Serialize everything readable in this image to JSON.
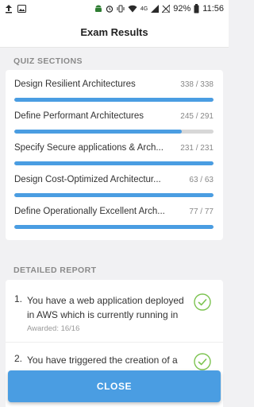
{
  "status_bar": {
    "battery_percent": "92%",
    "time": "11:56",
    "network_label": "4G"
  },
  "header": {
    "title": "Exam Results"
  },
  "quiz_sections": {
    "title": "QUIZ SECTIONS",
    "items": [
      {
        "label": "Design Resilient Architectures",
        "score": "338 / 338",
        "progress": 1.0
      },
      {
        "label": "Define Performant Architectures",
        "score": "245 / 291",
        "progress": 0.842
      },
      {
        "label": "Specify Secure applications & Arch...",
        "score": "231 / 231",
        "progress": 1.0
      },
      {
        "label": "Design Cost-Optimized Architectur...",
        "score": "63 / 63",
        "progress": 1.0
      },
      {
        "label": "Define Operationally Excellent Arch...",
        "score": "77 / 77",
        "progress": 1.0
      }
    ]
  },
  "detailed_report": {
    "title": "DETAILED REPORT",
    "items": [
      {
        "number": "1.",
        "text": "You have a web application deployed in AWS which is currently running in",
        "awarded": "Awarded: 16/16"
      },
      {
        "number": "2.",
        "text": "You have triggered the creation of a",
        "awarded": ""
      }
    ]
  },
  "footer": {
    "close_label": "CLOSE"
  },
  "colors": {
    "accent": "#4a9de2",
    "check": "#7cc350",
    "track": "#d7d7d7"
  }
}
